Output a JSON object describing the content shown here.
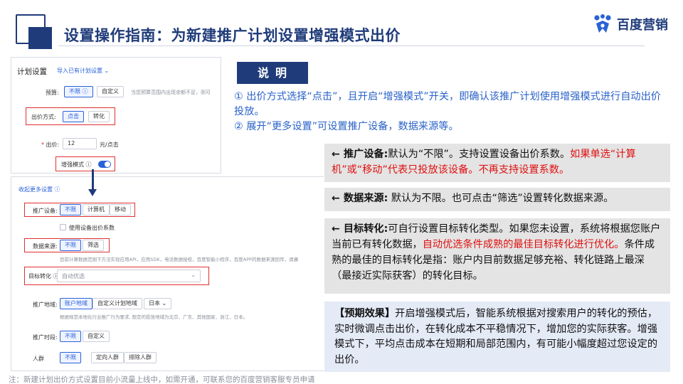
{
  "header": {
    "title": "设置操作指南：为新建推广计划设置增强模式出价",
    "brand_text": "百度营销"
  },
  "plan_panel": {
    "heading": "计划设置",
    "import_link": "导入已有计划设置",
    "budget_label": "预算:",
    "budget_unlimited": "不限",
    "budget_custom": "自定义",
    "budget_hint": "当您预算范围内出现余额不足，则可",
    "bid_method_label": "出价方式:",
    "bid_method_click": "点击",
    "bid_method_conversion": "转化",
    "bid_label": "出价:",
    "bid_value": "12",
    "bid_unit": "元/点击",
    "enhanced_label": "增强模式"
  },
  "more_panel": {
    "collapse_link": "收起更多设置",
    "device_label": "推广设备:",
    "device_options": [
      "不限",
      "计算机",
      "移动"
    ],
    "device_checkbox": "使用设备出价系数",
    "source_label": "数据来源:",
    "source_options": [
      "不限",
      "筛选"
    ],
    "source_hint": "目前计算数据范围下方法实现应用API，应用SDK，电话数据授权，百度智能小程序，百度APP的数据来源回传，请遵",
    "target_label": "目标转化",
    "target_value": "自动优选",
    "region_label": "推广地域:",
    "region_options": [
      "账户地域",
      "自定义计划地域"
    ],
    "region_select": "日本",
    "region_hint": "根据规范本地化行业推广行为要求, 限定的投放地域为北京、广东、其他国家、浙江、日本。",
    "time_label": "推广时段:",
    "time_options": [
      "不限",
      "自定义"
    ],
    "audience_label": "人群",
    "audience_options": [
      "不限",
      "定向人群",
      "排除人群"
    ]
  },
  "explain": {
    "tag": "说明",
    "line1": "① 出价方式选择“点击”，且开启“增强模式”开关，即确认该推广计划使用增强模式进行自动出价投放。",
    "line2": "② 展开“更多设置”可设置推广设备，数据来源等。"
  },
  "callouts": {
    "device_title": "← 推广设备:",
    "device_text": "默认为“不限”。支持设置设备出价系数。",
    "device_red": "如果单选“计算机”或“移动”代表只投放该设备。不再支持设置系数。",
    "source_title": "← 数据来源:",
    "source_text": "默认为不限。也可点击“筛选”设置转化数据来源。",
    "target_title": "← 目标转化:",
    "target_text1": "可自行设置目标转化类型。如果您未设置，系统将根据您账户当前已有转化数据，",
    "target_red": "自动优选条件成熟的最佳目标转化进行优化。",
    "target_text2": "条件成熟的最佳的目标转化是指：账户内目前数据足够充裕、转化链路上最深（最接近实际获客）的转化目标。"
  },
  "effect": {
    "title": "【预期效果】",
    "text": "开启增强模式后，智能系统根据对搜索用户的转化的预估，实时微调点击出价，在转化成本不平稳情况下，增加您的实际获客。增强模式下，平均点击成本在短期和局部范围内，有可能小幅度超过您设定的出价。"
  },
  "footnote": "注：新建计划出价方式设置目前小流量上线中，如需开通，可联系您的百度营销客服专员申请",
  "colors": {
    "brand_navy": "#1f3b7a",
    "link_blue": "#2962d9",
    "highlight_red": "#e01010",
    "callout_gray": "#e4e4e4",
    "effect_blue": "#e4eaf6"
  }
}
